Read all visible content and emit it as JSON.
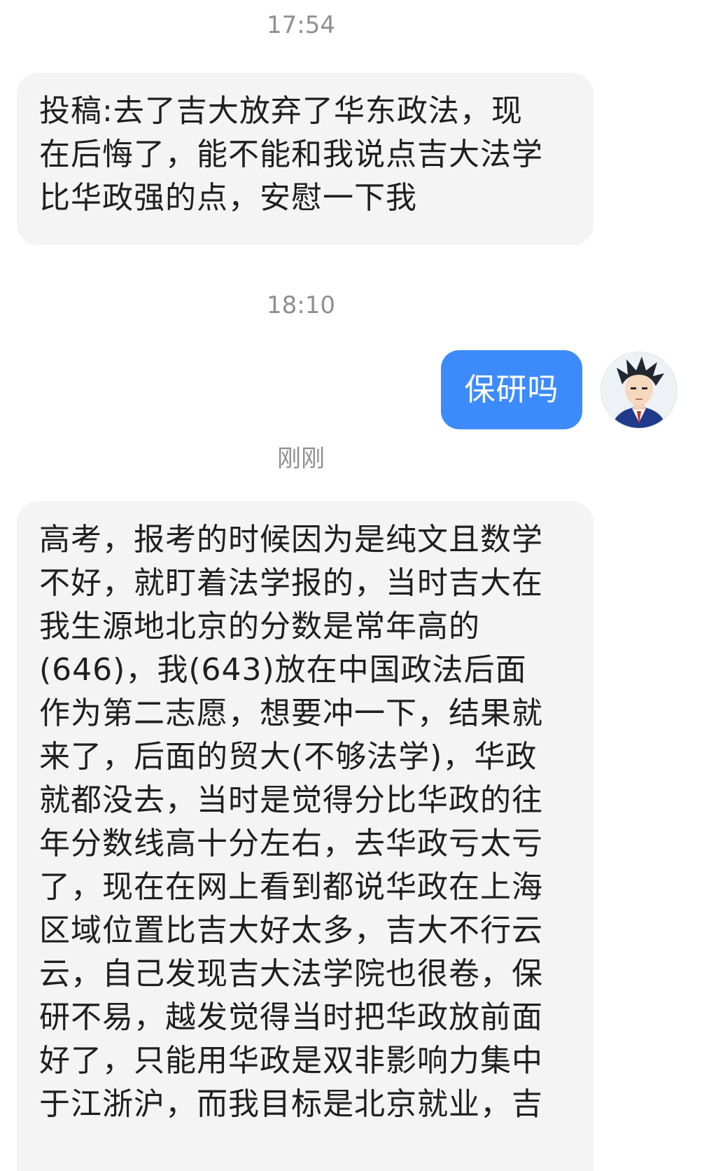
{
  "timestamps": {
    "first": "17:54",
    "second": "18:10",
    "third": "刚刚"
  },
  "messages": {
    "incoming_1": "投稿:去了吉大放弃了华东政法，现\n在后悔了，能不能和我说点吉大法学\n比华政强的点，安慰一下我",
    "outgoing_1": "保研吗",
    "incoming_2": "高考，报考的时候因为是纯文且数学\n不好，就盯着法学报的，当时吉大在\n我生源地北京的分数是常年高的\n(646)，我(643)放在中国政法后面\n作为第二志愿，想要冲一下，结果就\n来了，后面的贸大(不够法学)，华政\n就都没去，当时是觉得分比华政的往\n年分数线高十分左右，去华政亏太亏\n了，现在在网上看到都说华政在上海\n区域位置比吉大好太多，吉大不行云\n云，自己发现吉大法学院也很卷，保\n研不易，越发觉得当时把华政放前面\n好了，只能用华政是双非影响力集中\n于江浙沪，而我目标是北京就业，吉"
  },
  "colors": {
    "outgoing_bubble": "#3d8bfa",
    "incoming_bubble": "#f4f4f4",
    "timestamp_text": "#8f8f94"
  },
  "icons": {
    "avatar": "anime-lawyer-avatar-icon"
  }
}
